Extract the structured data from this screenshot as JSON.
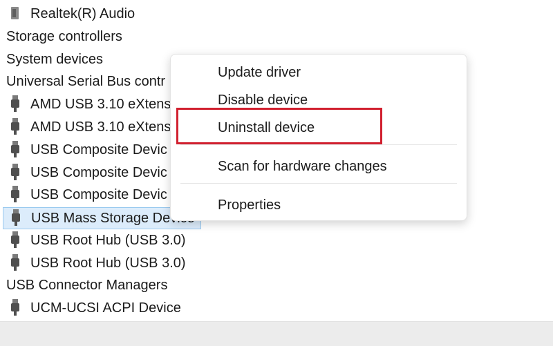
{
  "tree": {
    "rows": [
      {
        "label": "Realtek(R) Audio",
        "kind": "speaker"
      },
      {
        "label": "Storage controllers",
        "kind": "category"
      },
      {
        "label": "System devices",
        "kind": "category"
      },
      {
        "label": "Universal Serial Bus contr",
        "kind": "category"
      },
      {
        "label": "AMD USB 3.10 eXtens",
        "kind": "usb"
      },
      {
        "label": "AMD USB 3.10 eXtens",
        "kind": "usb"
      },
      {
        "label": "USB Composite Devic",
        "kind": "usb"
      },
      {
        "label": "USB Composite Devic",
        "kind": "usb"
      },
      {
        "label": "USB Composite Devic",
        "kind": "usb"
      },
      {
        "label": "USB Mass Storage Device",
        "kind": "usb",
        "selected": true
      },
      {
        "label": "USB Root Hub (USB 3.0)",
        "kind": "usb"
      },
      {
        "label": "USB Root Hub (USB 3.0)",
        "kind": "usb"
      },
      {
        "label": "USB Connector Managers",
        "kind": "category"
      },
      {
        "label": "UCM-UCSI ACPI Device",
        "kind": "usb"
      }
    ]
  },
  "context_menu": {
    "update_driver": "Update driver",
    "disable_device": "Disable device",
    "uninstall_device": "Uninstall device",
    "scan_hardware": "Scan for hardware changes",
    "properties": "Properties"
  },
  "colors": {
    "highlight_border": "#d1202f",
    "selection_bg": "#dcecfb"
  }
}
